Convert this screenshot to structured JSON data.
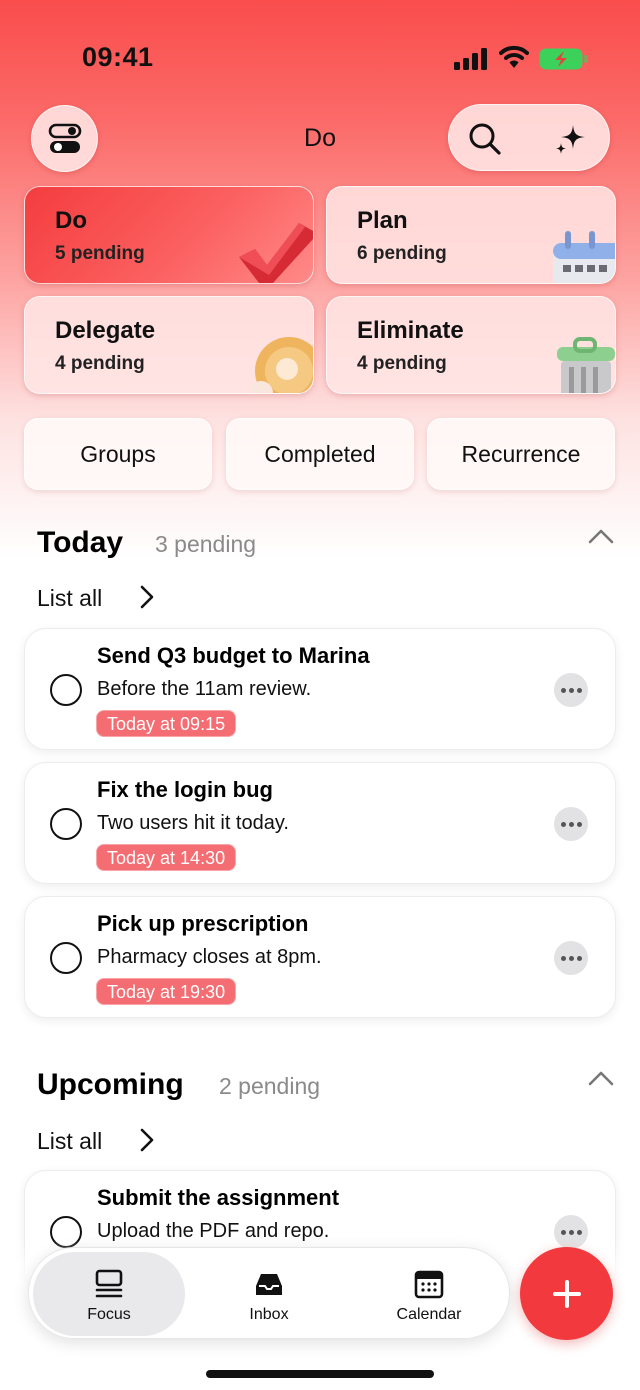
{
  "status": {
    "time": "09:41"
  },
  "header": {
    "title": "Do"
  },
  "quadrants": [
    {
      "title": "Do",
      "subtitle": "5 pending",
      "icon": "checkmark-3d-icon"
    },
    {
      "title": "Plan",
      "subtitle": "6 pending",
      "icon": "calendar-3d-icon"
    },
    {
      "title": "Delegate",
      "subtitle": "4 pending",
      "icon": "donut-3d-icon"
    },
    {
      "title": "Eliminate",
      "subtitle": "4 pending",
      "icon": "trash-can-3d-icon"
    }
  ],
  "chips": [
    "Groups",
    "Completed",
    "Recurrence"
  ],
  "today": {
    "title": "Today",
    "count": "3 pending",
    "list_all": "List all",
    "tasks": [
      {
        "title": "Send Q3 budget to Marina",
        "note": "Before the 11am review.",
        "due": "Today at 09:15"
      },
      {
        "title": "Fix the login bug",
        "note": "Two users hit it today.",
        "due": "Today at 14:30"
      },
      {
        "title": "Pick up prescription",
        "note": "Pharmacy closes at 8pm.",
        "due": "Today at 19:30"
      }
    ]
  },
  "upcoming": {
    "title": "Upcoming",
    "count": "2 pending",
    "list_all": "List all",
    "tasks": [
      {
        "title": "Submit the assignment",
        "note": "Upload the PDF and repo."
      }
    ]
  },
  "tabs": [
    {
      "label": "Focus",
      "icon": "focus-icon"
    },
    {
      "label": "Inbox",
      "icon": "inbox-icon"
    },
    {
      "label": "Calendar",
      "icon": "calendar-icon"
    }
  ],
  "colors": {
    "accent": "#f2393e",
    "due_badge": "#f46d72"
  }
}
